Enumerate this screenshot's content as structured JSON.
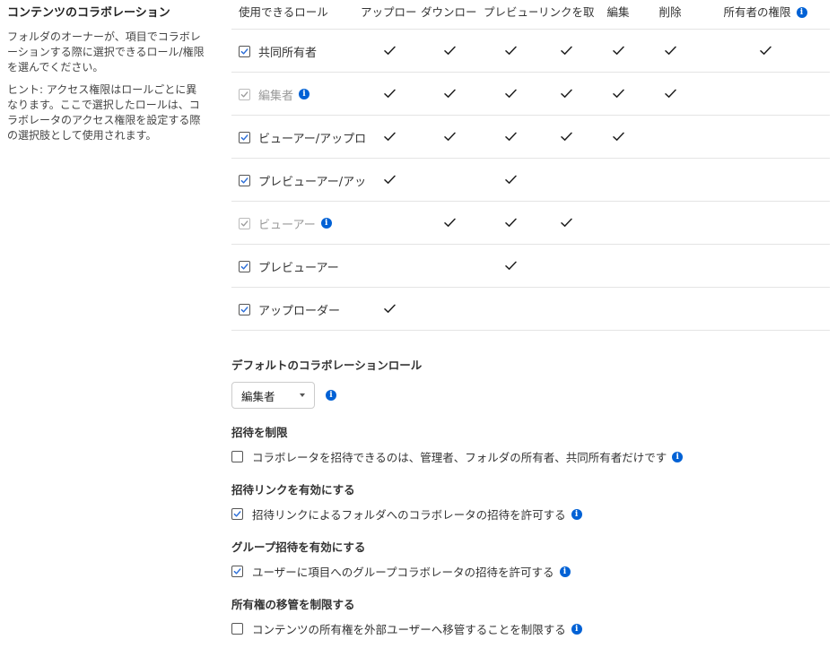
{
  "sidebar": {
    "title": "コンテンツのコラボレーション",
    "description": "フォルダのオーナーが、項目でコラボレーションする際に選択できるロール/権限を選んでください。",
    "hint": "ヒント: アクセス権限はロールごとに異なります。ここで選択したロールは、コラボレータのアクセス権限を設定する際の選択肢として使用されます。"
  },
  "roles_table": {
    "headers": {
      "role": "使用できるロール",
      "upload": "アップロード",
      "download": "ダウンロード",
      "preview": "プレビュー",
      "get_link": "リンクを取得",
      "edit": "編集",
      "delete": "削除",
      "owner_perm": "所有者の権限"
    },
    "rows": [
      {
        "label": "共同所有者",
        "checked": true,
        "disabled": false,
        "info": false,
        "perms": [
          true,
          true,
          true,
          true,
          true,
          true,
          true
        ]
      },
      {
        "label": "編集者",
        "checked": true,
        "disabled": true,
        "info": true,
        "perms": [
          true,
          true,
          true,
          true,
          true,
          true,
          false
        ]
      },
      {
        "label": "ビューアー/アップロ",
        "checked": true,
        "disabled": false,
        "info": false,
        "perms": [
          true,
          true,
          true,
          true,
          true,
          false,
          false
        ]
      },
      {
        "label": "プレビューアー/アッ",
        "checked": true,
        "disabled": false,
        "info": false,
        "perms": [
          true,
          false,
          true,
          false,
          false,
          false,
          false
        ]
      },
      {
        "label": "ビューアー",
        "checked": true,
        "disabled": true,
        "info": true,
        "perms": [
          false,
          true,
          true,
          true,
          false,
          false,
          false
        ]
      },
      {
        "label": "プレビューアー",
        "checked": true,
        "disabled": false,
        "info": false,
        "perms": [
          false,
          false,
          true,
          false,
          false,
          false,
          false
        ]
      },
      {
        "label": "アップローダー",
        "checked": true,
        "disabled": false,
        "info": false,
        "perms": [
          true,
          false,
          false,
          false,
          false,
          false,
          false
        ]
      }
    ]
  },
  "default_role": {
    "title": "デフォルトのコラボレーションロール",
    "selected": "編集者"
  },
  "restrict_invite": {
    "title": "招待を制限",
    "label": "コラボレータを招待できるのは、管理者、フォルダの所有者、共同所有者だけです",
    "checked": false
  },
  "invite_link": {
    "title": "招待リンクを有効にする",
    "label": "招待リンクによるフォルダへのコラボレータの招待を許可する",
    "checked": true
  },
  "group_invite": {
    "title": "グループ招待を有効にする",
    "label": "ユーザーに項目へのグループコラボレータの招待を許可する",
    "checked": true
  },
  "ownership_transfer": {
    "title": "所有権の移管を制限する",
    "label": "コンテンツの所有権を外部ユーザーへ移管することを制限する",
    "checked": false
  },
  "colors": {
    "accent": "#0061d5",
    "text": "#333333",
    "disabled_text": "#999999",
    "divider": "#e4e4e4"
  },
  "icons": {
    "info": "info-icon",
    "check": "checkmark-icon",
    "dropdown": "chevron-down-icon"
  }
}
